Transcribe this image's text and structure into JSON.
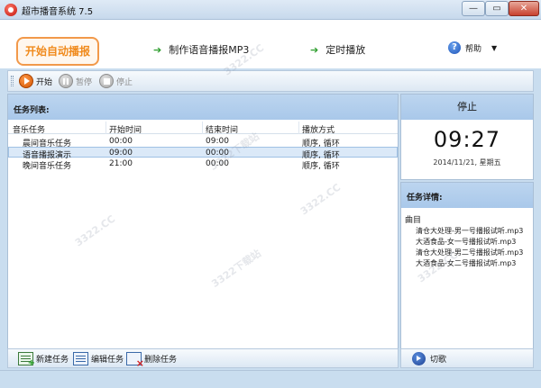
{
  "window": {
    "title": "超市播音系统 7.5",
    "min_glyph": "—",
    "max_glyph": "▭",
    "close_glyph": "✕"
  },
  "nav": {
    "auto_play": "开始自动播报",
    "make_mp3": "制作语音播报MP3",
    "timed_play": "定时播放",
    "help": "帮助",
    "arrow_glyph": "➔",
    "help_glyph": "?",
    "caret_glyph": "▼"
  },
  "toolbar": {
    "start": "开始",
    "pause": "暂停",
    "stop": "停止"
  },
  "tasks": {
    "header": "任务列表:",
    "columns": [
      "音乐任务",
      "开始时间",
      "结束时间",
      "播放方式"
    ],
    "rows": [
      {
        "name": "晨间音乐任务",
        "start": "00:00",
        "end": "09:00",
        "mode": "顺序, 循环"
      },
      {
        "name": "语音播报演示",
        "start": "09:00",
        "end": "00:00",
        "mode": "顺序, 循环"
      },
      {
        "name": "晚间音乐任务",
        "start": "21:00",
        "end": "00:00",
        "mode": "顺序, 循环"
      }
    ],
    "selected_index": 1,
    "new_task": "新建任务",
    "edit_task": "编辑任务",
    "delete_task": "删除任务"
  },
  "status": {
    "state": "停止",
    "time": "09:27",
    "date": "2014/11/21, 星期五"
  },
  "details": {
    "header": "任务详情:",
    "track_header": "曲目",
    "tracks": [
      "清仓大处理-男一号播报试听.mp3",
      "大酒食品-女一号播报试听.mp3",
      "清仓大处理-男二号播报试听.mp3",
      "大酒食品-女二号播报试听.mp3"
    ],
    "cut_song": "切歌"
  },
  "watermark": "3322下载站",
  "watermark_site": "3322.CC",
  "colors": {
    "accent_orange": "#f08a1c",
    "panel_header": "#a9c8ea",
    "window_bg": "#c9ddef"
  }
}
